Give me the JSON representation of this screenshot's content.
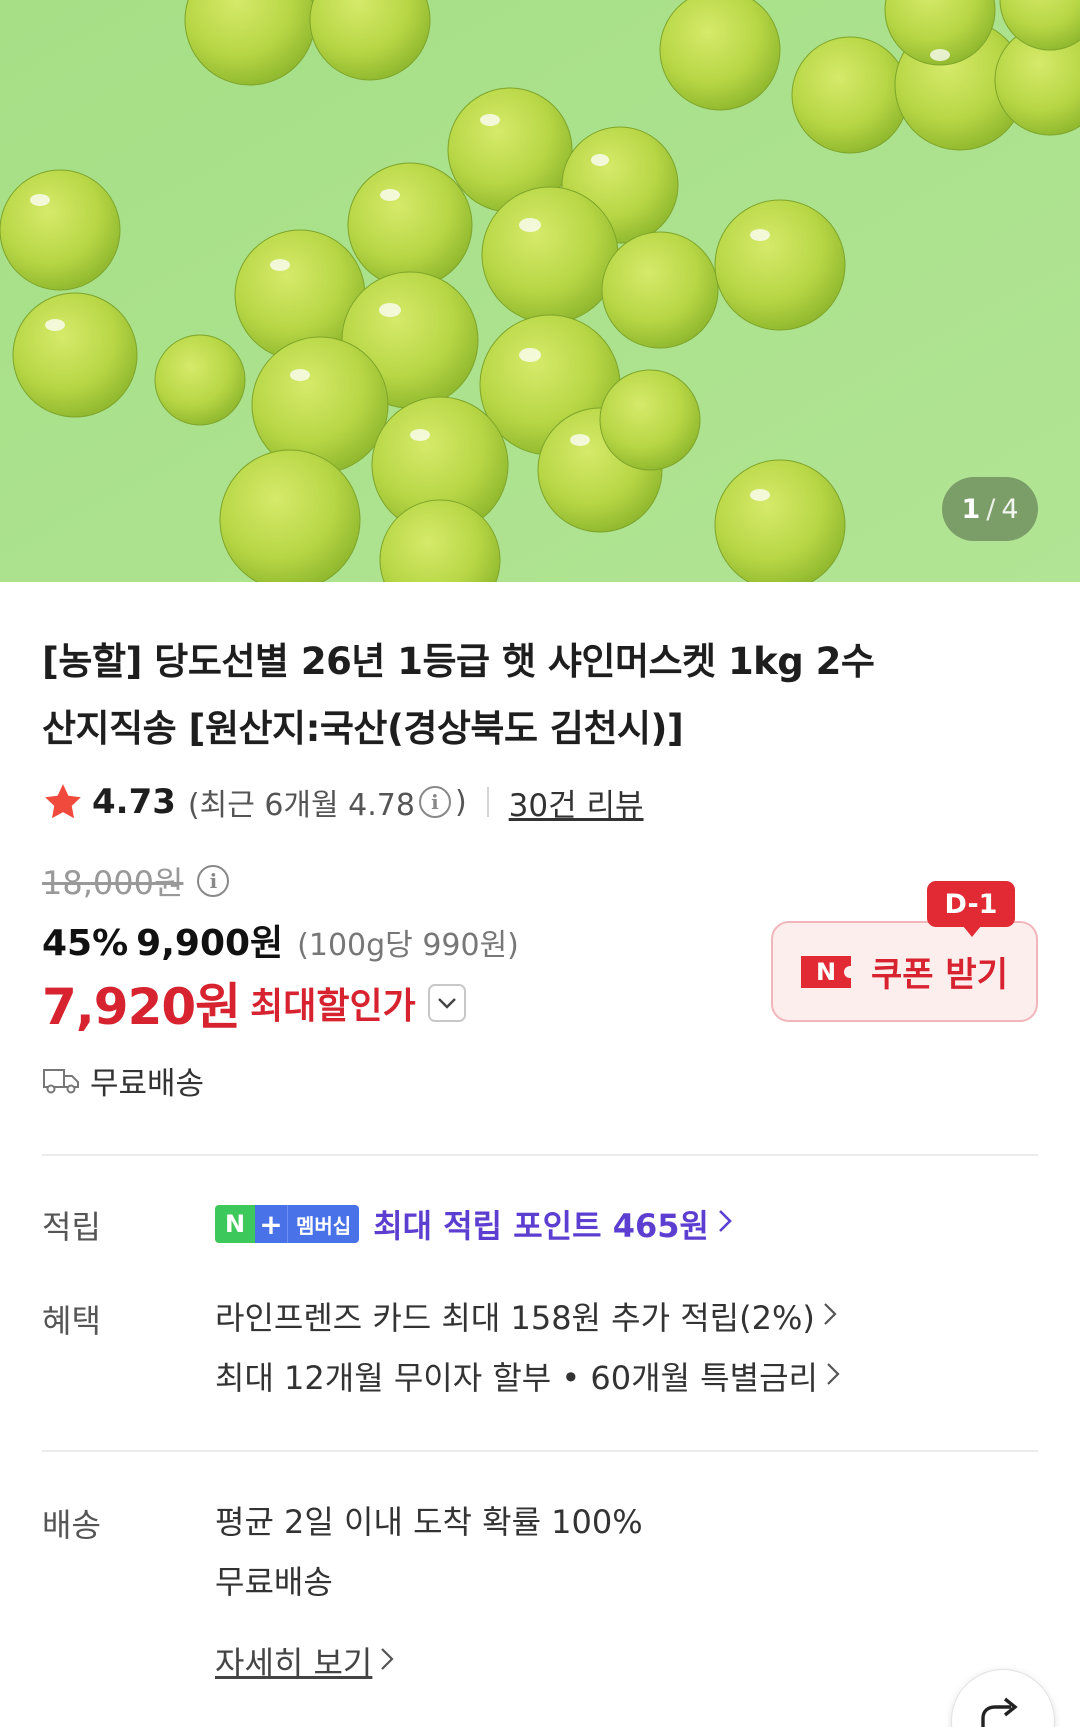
{
  "gallery": {
    "current": "1",
    "separator": "/",
    "total": "4"
  },
  "product": {
    "title_line1": "[농할] 당도선별 26년 1등급 햇 샤인머스켓 1kg 2수",
    "title_line2": "산지직송 [원산지:국산(경상북도 김천시)]"
  },
  "rating": {
    "score": "4.73",
    "recent_prefix": "(최근 6개월 4.78",
    "recent_suffix": ")",
    "review_link": "30건 리뷰"
  },
  "price": {
    "original": "18,000원",
    "discount_percent": "45%",
    "sale": "9,900원",
    "unit": "(100g당 990원)",
    "max_discount": "7,920원",
    "max_label": "최대할인가"
  },
  "coupon": {
    "dday": "D-1",
    "n_badge": "N",
    "label": "쿠폰 받기"
  },
  "free_shipping": "무료배송",
  "points_row": {
    "label": "적립",
    "badge_n": "N",
    "badge_plus": "+",
    "badge_text": "멤버십",
    "text": "최대 적립 포인트 465원"
  },
  "benefit_row": {
    "label": "혜택",
    "line1": "라인프렌즈 카드 최대 158원 추가 적립(2%)",
    "line2": "최대 12개월 무이자 할부 • 60개월 특별금리"
  },
  "shipping_row": {
    "label": "배송",
    "line1": "평균 2일 이내 도착 확률 100%",
    "line2": "무료배송",
    "detail_link": "자세히 보기"
  },
  "colors": {
    "accent_red": "#d6232f",
    "points_purple": "#5c3fd0",
    "hero_bg": "#a9e08a"
  }
}
